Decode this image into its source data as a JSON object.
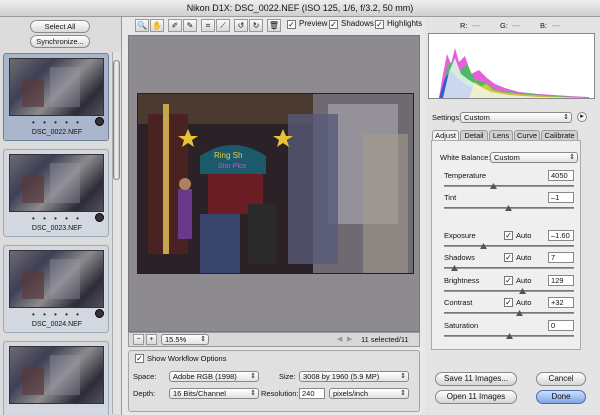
{
  "window": {
    "title": "Nikon D1X:  DSC_0022.NEF  (ISO 125, 1/6, f/3.2, 50 mm)"
  },
  "filmstrip": {
    "select_all": "Select All",
    "synchronize": "Synchronize...",
    "thumbs": [
      {
        "name": "DSC_0022.NEF",
        "rating": "• • • • •"
      },
      {
        "name": "DSC_0023.NEF",
        "rating": "• • • • •"
      },
      {
        "name": "DSC_0024.NEF",
        "rating": "• • • • •"
      },
      {
        "name": "",
        "rating": ""
      }
    ]
  },
  "toolbar": {
    "tools": [
      "zoom-icon",
      "hand-icon",
      "white-balance-icon",
      "color-sampler-icon",
      "crop-icon",
      "straighten-icon",
      "rotate-left-icon",
      "rotate-right-icon",
      "trash-icon"
    ],
    "tool_glyphs": [
      "🔍",
      "✋",
      "✐",
      "✎",
      "⌗",
      "⟋",
      "↺",
      "↻",
      "🗑"
    ],
    "preview_label": "Preview",
    "shadows_label": "Shadows",
    "highlights_label": "Highlights",
    "preview_checked": "✓",
    "shadows_checked": "✓",
    "highlights_checked": "✓"
  },
  "status": {
    "zoom": "15.5%",
    "selection": "11 selected/11"
  },
  "workflow": {
    "show_label": "Show Workflow Options",
    "checked": "✓",
    "space_label": "Space:",
    "space_value": "Adobe RGB (1998)",
    "size_label": "Size:",
    "size_value": "3008 by 1960  (5.9 MP)",
    "depth_label": "Depth:",
    "depth_value": "16 Bits/Channel",
    "resolution_label": "Resolution:",
    "resolution_value": "240",
    "resolution_unit": "pixels/inch"
  },
  "rgb_readout": {
    "r": "R:",
    "g": "G:",
    "b": "B:",
    "r_val": "---",
    "g_val": "---",
    "b_val": "---"
  },
  "settings": {
    "label": "Settings:",
    "value": "Custom"
  },
  "tabs": [
    "Adjust",
    "Detail",
    "Lens",
    "Curve",
    "Calibrate"
  ],
  "adjust": {
    "white_balance_label": "White Balance:",
    "white_balance_value": "Custom",
    "auto_label": "Auto",
    "auto_check": "✓",
    "controls": [
      {
        "label": "Temperature",
        "value": "4050",
        "level": 0.38,
        "auto": false
      },
      {
        "label": "Tint",
        "value": "–1",
        "level": 0.49,
        "auto": false
      },
      {
        "label": "Exposure",
        "value": "–1.60",
        "level": 0.3,
        "auto": true
      },
      {
        "label": "Shadows",
        "value": "7",
        "level": 0.08,
        "auto": true
      },
      {
        "label": "Brightness",
        "value": "129",
        "level": 0.6,
        "auto": true
      },
      {
        "label": "Contrast",
        "value": "+32",
        "level": 0.58,
        "auto": true
      },
      {
        "label": "Saturation",
        "value": "0",
        "level": 0.5,
        "auto": false
      }
    ]
  },
  "buttons": {
    "save": "Save 11 Images...",
    "open": "Open 11 Images",
    "cancel": "Cancel",
    "done": "Done"
  }
}
